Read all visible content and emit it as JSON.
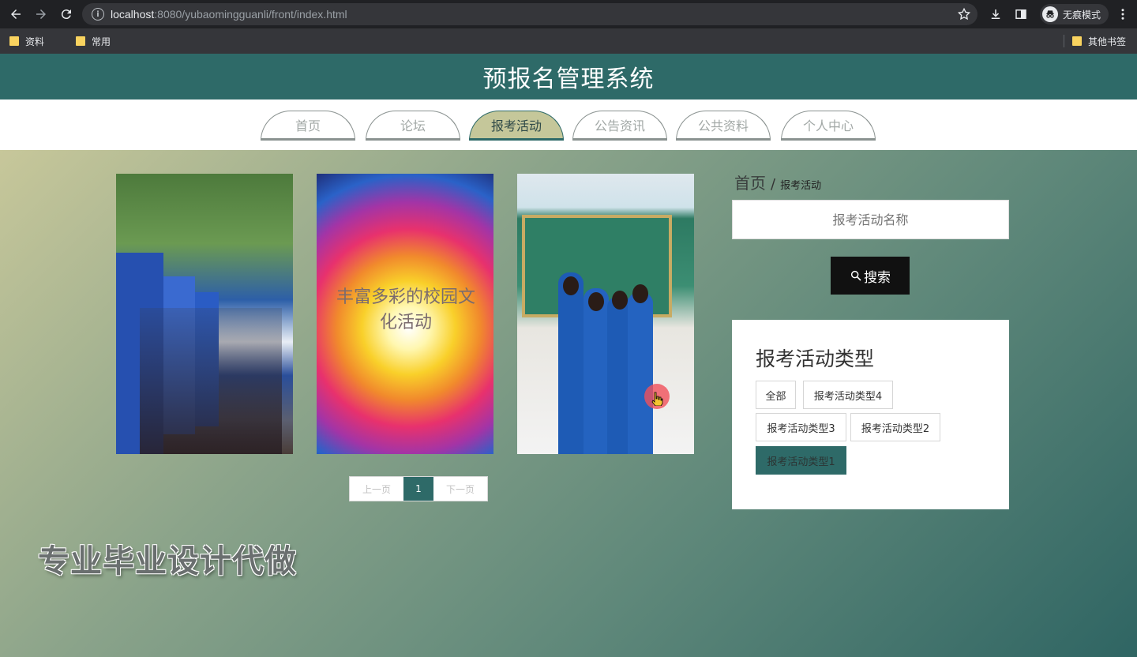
{
  "browser": {
    "url_host": "localhost",
    "url_rest": ":8080/yubaomingguanli/front/index.html",
    "incognito_label": "无痕模式",
    "bookmarks": [
      "资料",
      "常用"
    ],
    "other_bookmarks": "其他书签",
    "icons": [
      "back-icon",
      "forward-icon",
      "reload-icon",
      "info-icon",
      "star-icon",
      "download-icon",
      "sidebar-icon",
      "incognito-icon",
      "menu-icon",
      "folder-icon"
    ]
  },
  "site": {
    "title": "预报名管理系统",
    "nav": [
      "首页",
      "论坛",
      "报考活动",
      "公告资讯",
      "公共资料",
      "个人中心"
    ],
    "active_nav": "报考活动"
  },
  "cards": [
    {
      "alt": "campus tents"
    },
    {
      "caption": "丰富多彩的校园文化活动"
    },
    {
      "alt": "students group"
    }
  ],
  "pager": {
    "prev": "上一页",
    "current": "1",
    "next": "下一页"
  },
  "watermark": "专业毕业设计代做",
  "breadcrumb": {
    "home": "首页",
    "sep": "/",
    "current": "报考活动"
  },
  "search": {
    "placeholder": "报考活动名称",
    "button": "搜索"
  },
  "types": {
    "title": "报考活动类型",
    "items": [
      "全部",
      "报考活动类型4",
      "报考活动类型3",
      "报考活动类型2",
      "报考活动类型1"
    ],
    "active": "报考活动类型1"
  },
  "colors": {
    "brand": "#2e6a68",
    "active_tab": "#c5c79a"
  }
}
